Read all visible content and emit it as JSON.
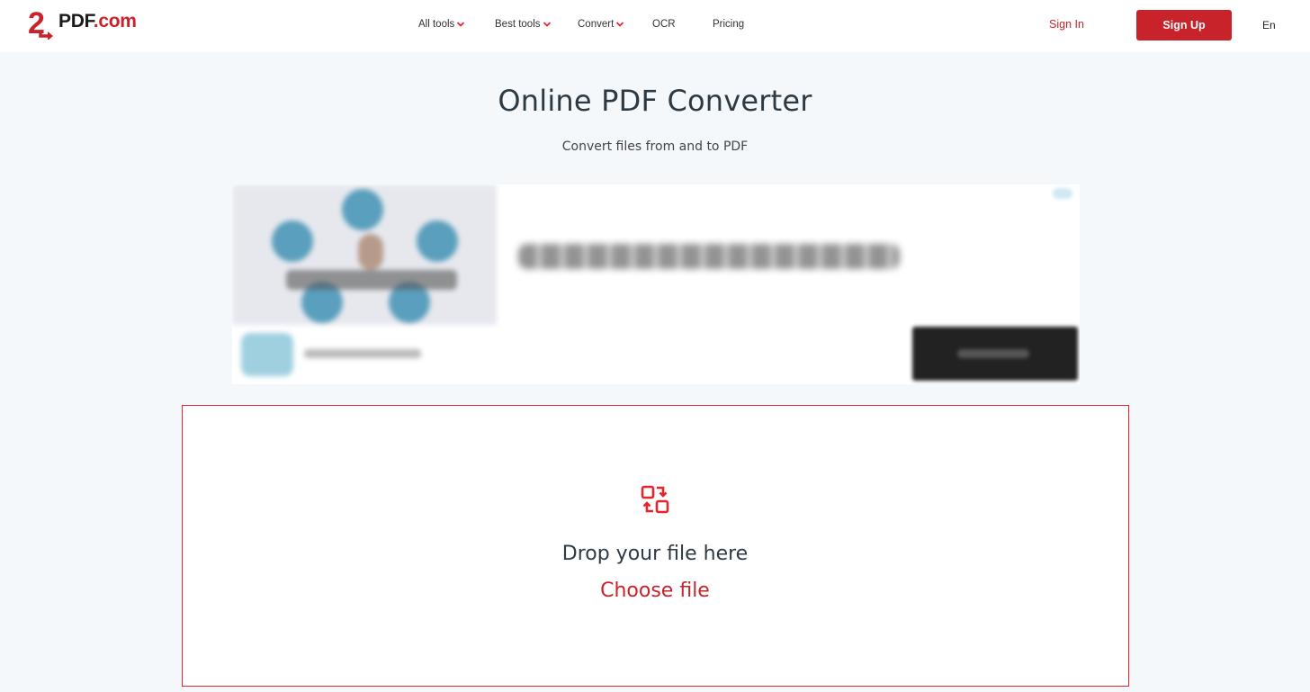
{
  "header": {
    "logo": {
      "prefix": "2",
      "main": "PDF",
      "suffix": ".com"
    },
    "nav": [
      {
        "label": "All tools",
        "has_dropdown": true
      },
      {
        "label": "Best tools",
        "has_dropdown": true
      },
      {
        "label": "Convert",
        "has_dropdown": true
      },
      {
        "label": "OCR",
        "has_dropdown": false
      },
      {
        "label": "Pricing",
        "has_dropdown": false
      }
    ],
    "sign_in_label": "Sign In",
    "sign_up_label": "Sign Up",
    "language": "En"
  },
  "hero": {
    "title": "Online PDF Converter",
    "subtitle": "Convert files from and to PDF"
  },
  "ad": {
    "state": "blurred advertisement"
  },
  "dropzone": {
    "icon": "convert-icon",
    "drop_text": "Drop your file here",
    "choose_label": "Choose file"
  },
  "colors": {
    "brand_red": "#c8232b",
    "dropzone_border": "#e3262e",
    "page_background": "#f4f8fb",
    "text_dark": "#2d3a44"
  }
}
